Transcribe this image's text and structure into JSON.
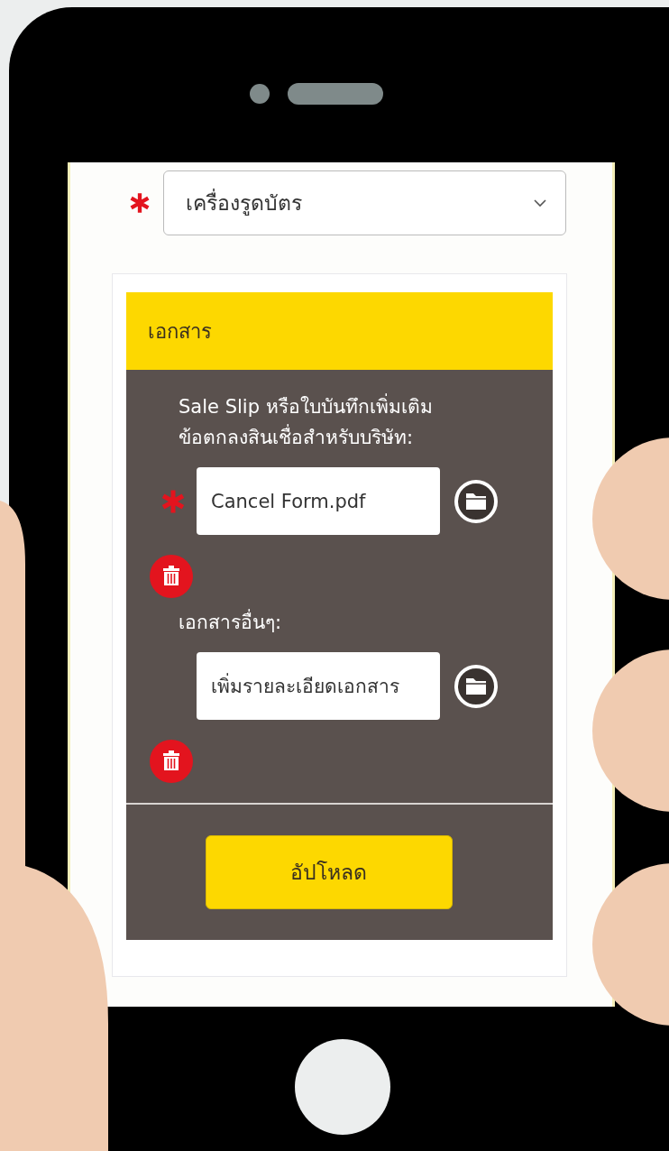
{
  "dropdown": {
    "required": true,
    "value": "เครื่องรูดบัตร"
  },
  "documents_panel": {
    "title": "เอกสาร",
    "fields": [
      {
        "label": "Sale Slip หรือใบบันทึกเพิ่มเติมข้อตกลงสินเชื่อสำหรับบริษัท:",
        "required": true,
        "value": "Cancel Form.pdf"
      },
      {
        "label": "เอกสารอื่นๆ:",
        "required": false,
        "value": "เพิ่มรายละเอียดเอกสาร"
      }
    ],
    "upload_button": "อัปโหลด"
  }
}
